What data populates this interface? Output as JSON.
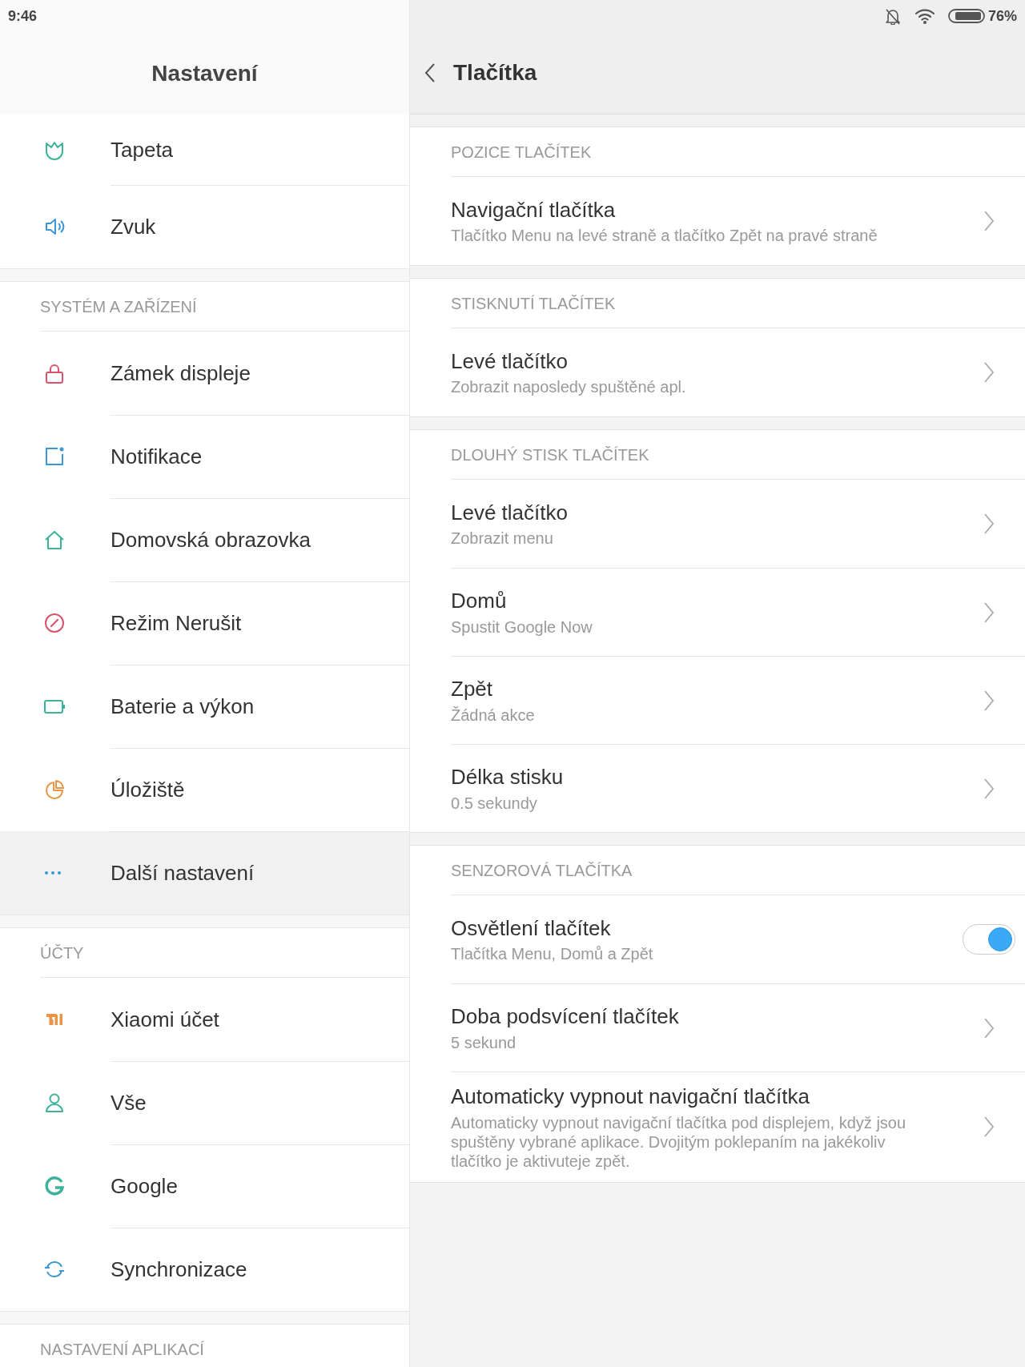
{
  "status_bar": {
    "time": "9:46",
    "battery": "76%"
  },
  "sidebar": {
    "title": "Nastavení",
    "sections": [
      {
        "items": [
          {
            "label": "Tapeta",
            "selected": false
          },
          {
            "label": "Zvuk",
            "selected": false
          }
        ]
      },
      {
        "header": "SYSTÉM A ZAŘÍZENÍ",
        "items": [
          {
            "label": "Zámek displeje",
            "selected": false
          },
          {
            "label": "Notifikace",
            "selected": false
          },
          {
            "label": "Domovská obrazovka",
            "selected": false
          },
          {
            "label": "Režim Nerušit",
            "selected": false
          },
          {
            "label": "Baterie a výkon",
            "selected": false
          },
          {
            "label": "Úložiště",
            "selected": false
          },
          {
            "label": "Další nastavení",
            "selected": true
          }
        ]
      },
      {
        "header": "ÚČTY",
        "items": [
          {
            "label": "Xiaomi účet",
            "selected": false
          },
          {
            "label": "Vše",
            "selected": false
          },
          {
            "label": "Google",
            "selected": false
          },
          {
            "label": "Synchronizace",
            "selected": false
          }
        ]
      },
      {
        "header": "NASTAVENÍ APLIKACÍ"
      }
    ]
  },
  "detail": {
    "title": "Tlačítka",
    "sections": [
      {
        "header": "POZICE TLAČÍTEK",
        "items": [
          {
            "kind": "link",
            "title": "Navigační tlačítka",
            "subtitle": "Tlačítko Menu na levé straně a tlačítko Zpět na pravé straně"
          }
        ]
      },
      {
        "header": "STISKNUTÍ TLAČÍTEK",
        "items": [
          {
            "kind": "link",
            "title": "Levé tlačítko",
            "subtitle": "Zobrazit naposledy spuštěné apl."
          }
        ]
      },
      {
        "header": "DLOUHÝ STISK TLAČÍTEK",
        "items": [
          {
            "kind": "link",
            "title": "Levé tlačítko",
            "subtitle": "Zobrazit menu"
          },
          {
            "kind": "link",
            "title": "Domů",
            "subtitle": "Spustit Google Now"
          },
          {
            "kind": "link",
            "title": "Zpět",
            "subtitle": "Žádná akce"
          },
          {
            "kind": "link",
            "title": "Délka stisku",
            "subtitle": "0.5 sekundy"
          }
        ]
      },
      {
        "header": "SENZOROVÁ TLAČÍTKA",
        "items": [
          {
            "kind": "toggle",
            "title": "Osvětlení tlačítek",
            "subtitle": "Tlačítka Menu, Domů a Zpět",
            "on": true
          },
          {
            "kind": "link",
            "title": "Doba podsvícení tlačítek",
            "subtitle": "5 sekund"
          },
          {
            "kind": "link",
            "title": "Automaticky vypnout navigační tlačítka",
            "subtitle": "Automaticky vypnout navigační tlačítka pod displejem, když jsou spuštěny vybrané aplikace. Dvojitým poklepaním na jakékoliv tlačítko je aktivuteje zpět."
          }
        ]
      }
    ]
  }
}
